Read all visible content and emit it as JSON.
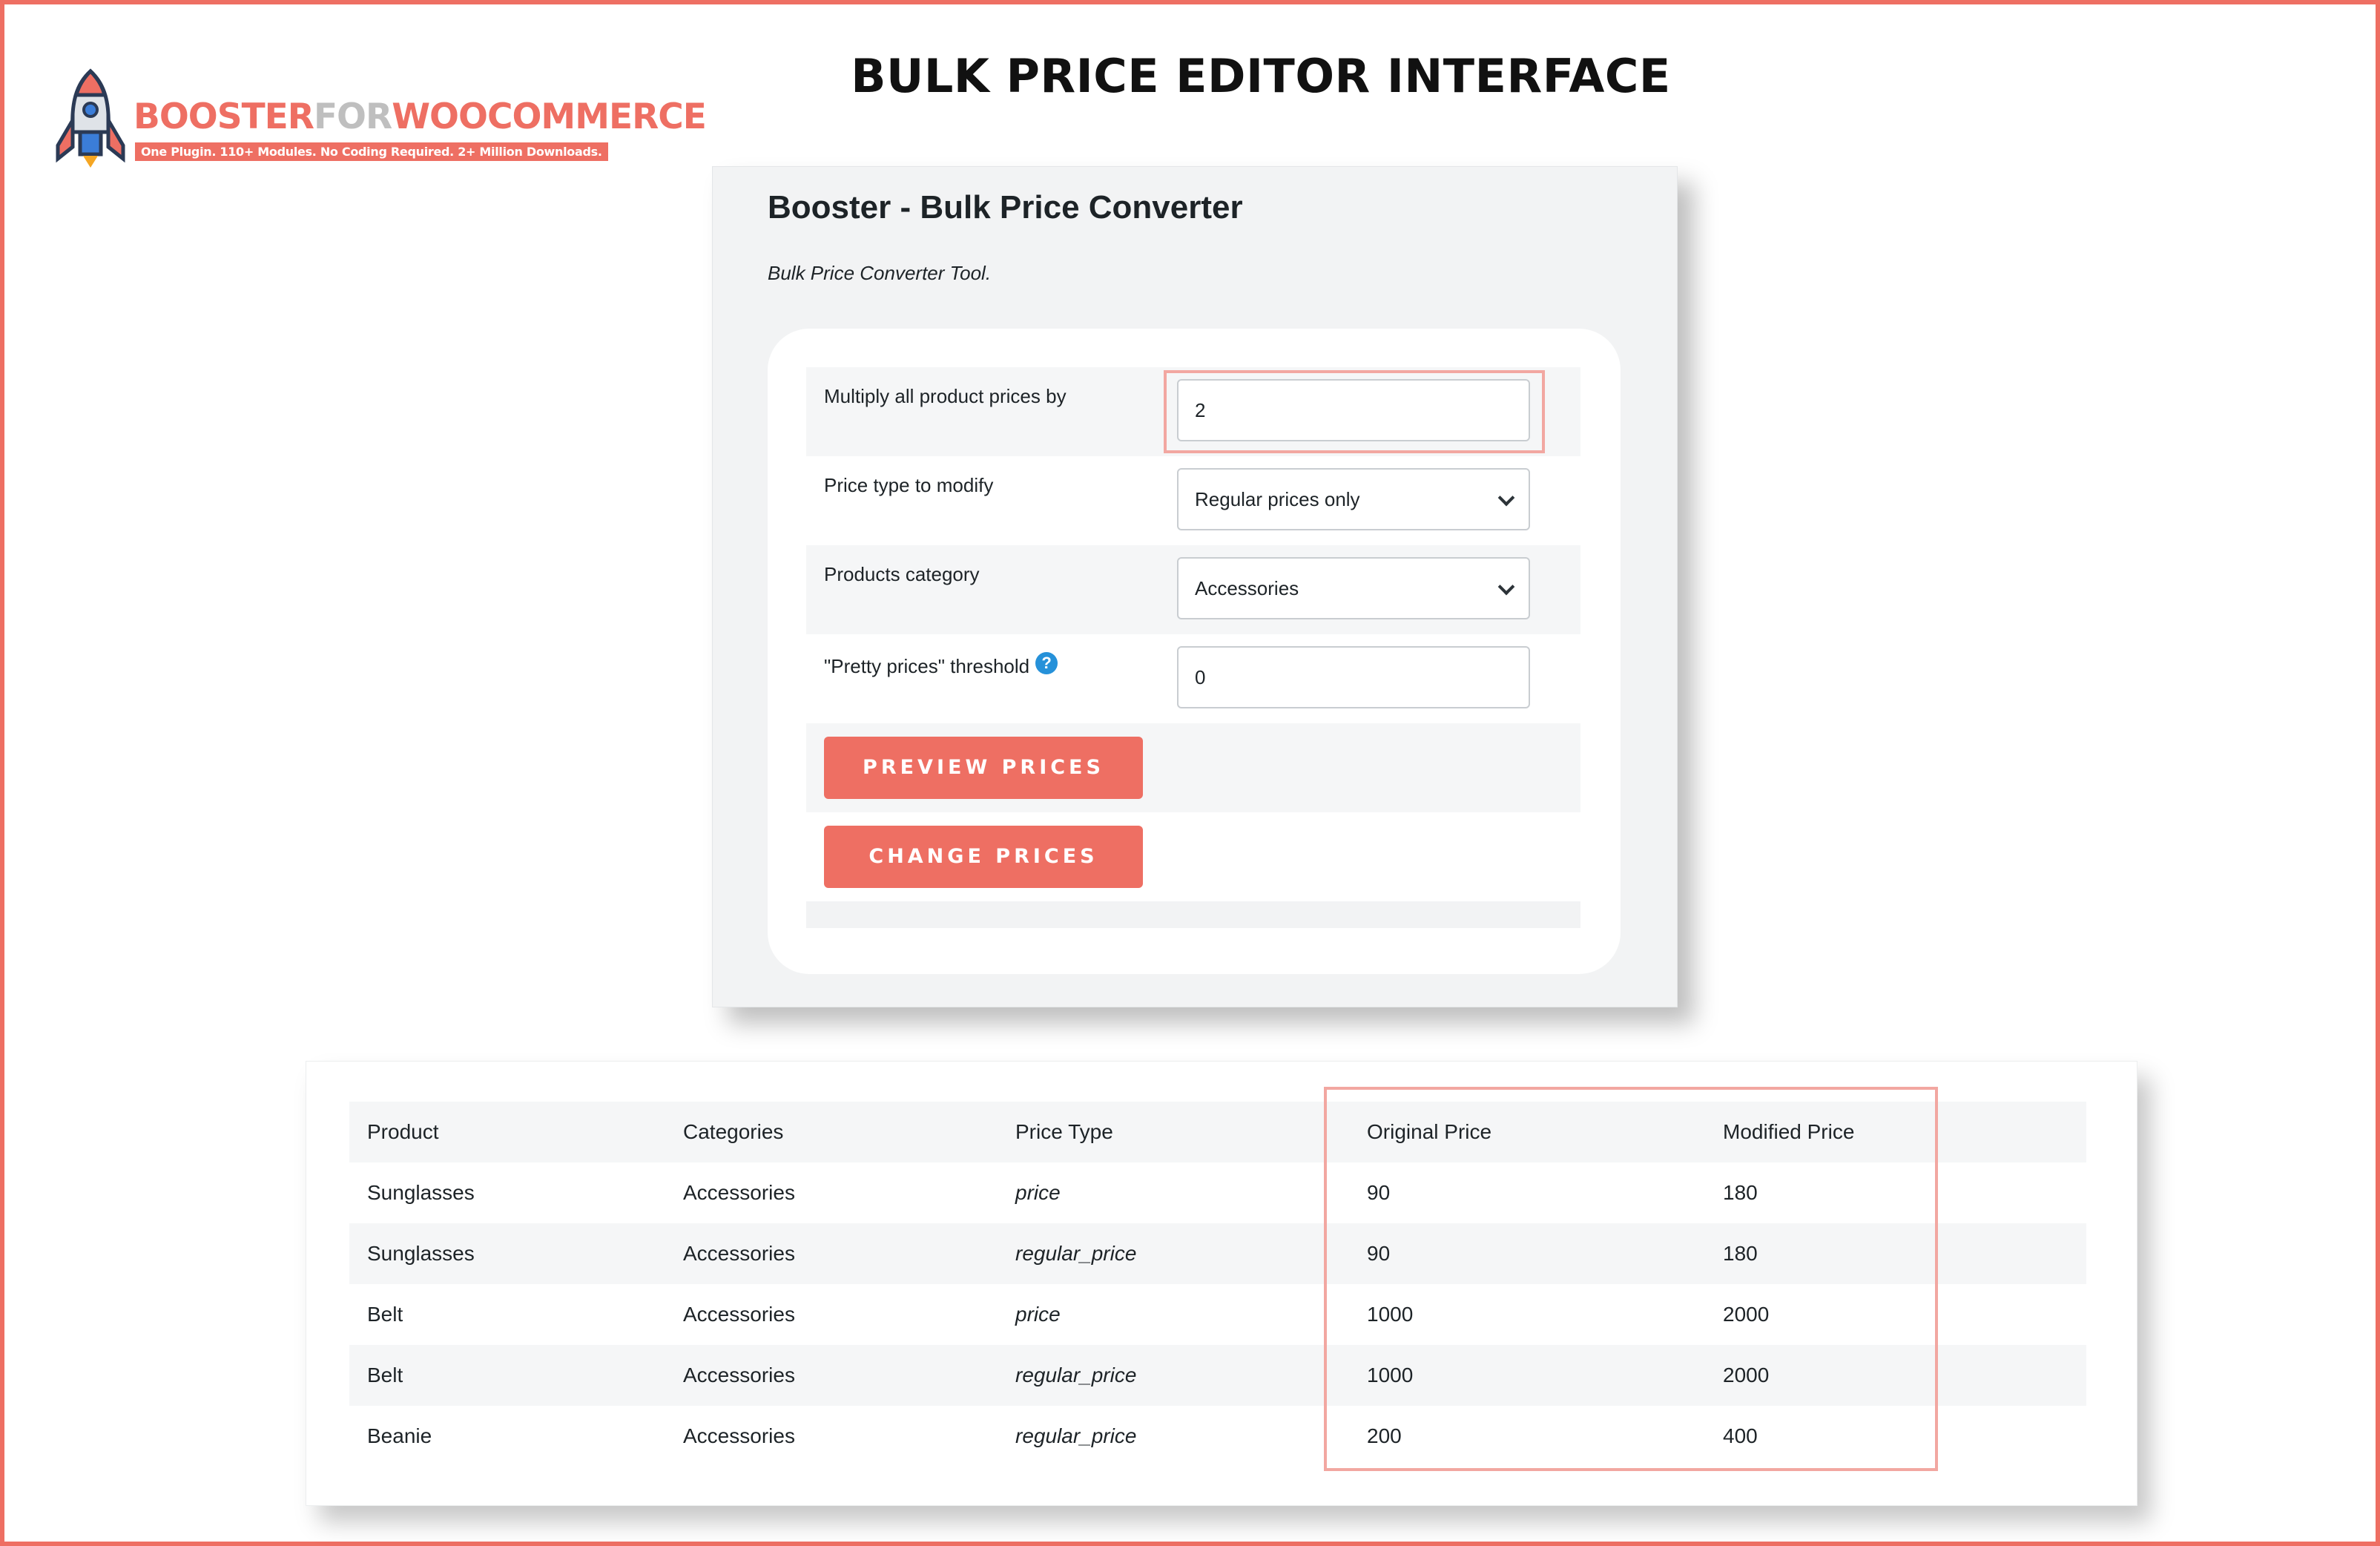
{
  "logo": {
    "word_booster": "BOOSTER",
    "word_for": "FOR",
    "word_woocommerce": "WOOCOMMERCE",
    "tagline": "One Plugin. 110+ Modules. No Coding Required. 2+ Million Downloads."
  },
  "page_heading": "BULK PRICE EDITOR INTERFACE",
  "tool": {
    "title": "Booster - Bulk Price Converter",
    "description": "Bulk Price Converter Tool.",
    "fields": {
      "multiply_label": "Multiply all product prices by",
      "multiply_value": "2",
      "price_type_label": "Price type to modify",
      "price_type_value": "Regular prices only",
      "category_label": "Products category",
      "category_value": "Accessories",
      "pretty_label": "\"Pretty prices\" threshold",
      "pretty_help": "?",
      "pretty_value": "0"
    },
    "buttons": {
      "preview": "PREVIEW PRICES",
      "change": "CHANGE PRICES"
    }
  },
  "results_table": {
    "headers": [
      "Product",
      "Categories",
      "Price Type",
      "Original Price",
      "Modified Price"
    ],
    "rows": [
      [
        "Sunglasses",
        "Accessories",
        "price",
        "90",
        "180"
      ],
      [
        "Sunglasses",
        "Accessories",
        "regular_price",
        "90",
        "180"
      ],
      [
        "Belt",
        "Accessories",
        "price",
        "1000",
        "2000"
      ],
      [
        "Belt",
        "Accessories",
        "regular_price",
        "1000",
        "2000"
      ],
      [
        "Beanie",
        "Accessories",
        "regular_price",
        "200",
        "400"
      ]
    ]
  },
  "colors": {
    "accent": "#ee6f63",
    "highlight_border": "#f2a7a1",
    "help_icon": "#2691d9"
  }
}
